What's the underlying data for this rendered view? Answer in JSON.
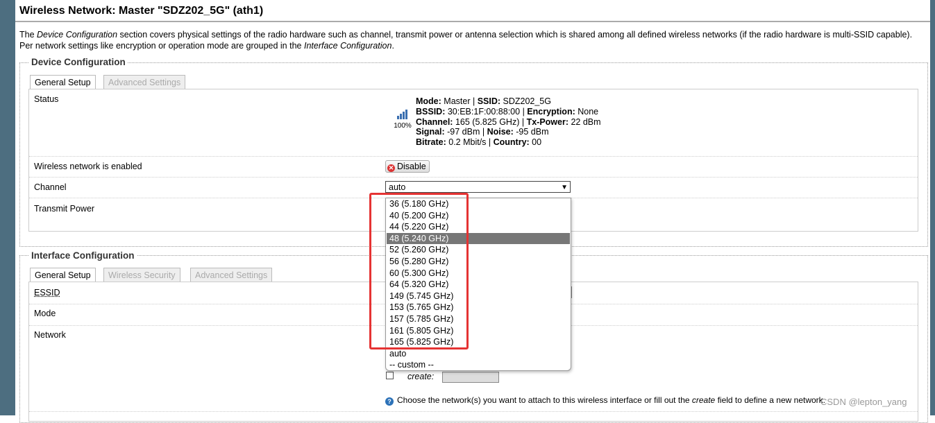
{
  "page": {
    "title": "Wireless Network: Master \"SDZ202_5G\" (ath1)",
    "description_parts": [
      "The ",
      "Device Configuration",
      " section covers physical settings of the radio hardware such as channel, transmit power or antenna selection which is shared among all defined wireless networks (if the radio hardware is multi-SSID capable). Per network settings like encryption or operation mode are grouped in the ",
      "Interface Configuration",
      "."
    ]
  },
  "device_config": {
    "legend": "Device Configuration",
    "tabs": [
      {
        "label": "General Setup",
        "active": true
      },
      {
        "label": "Advanced Settings",
        "active": false
      }
    ],
    "status_label": "Status",
    "signal_percent": "100%",
    "status_lines": [
      [
        {
          "k": "Mode:",
          "v": " Master | "
        },
        {
          "k": "SSID:",
          "v": " SDZ202_5G"
        }
      ],
      [
        {
          "k": "BSSID:",
          "v": " 30:EB:1F:00:88:00 | "
        },
        {
          "k": "Encryption:",
          "v": " None"
        }
      ],
      [
        {
          "k": "Channel:",
          "v": " 165 (5.825 GHz) | "
        },
        {
          "k": "Tx-Power:",
          "v": " 22 dBm"
        }
      ],
      [
        {
          "k": "Signal:",
          "v": " -97 dBm | "
        },
        {
          "k": "Noise:",
          "v": " -95 dBm"
        }
      ],
      [
        {
          "k": "Bitrate:",
          "v": " 0.2 Mbit/s | "
        },
        {
          "k": "Country:",
          "v": " 00"
        }
      ]
    ],
    "enabled_label": "Wireless network is enabled",
    "disable_button": "Disable",
    "channel_label": "Channel",
    "channel_value": "auto",
    "txpower_label": "Transmit Power"
  },
  "channel_dropdown": {
    "options": [
      "36 (5.180 GHz)",
      "40 (5.200 GHz)",
      "44 (5.220 GHz)",
      "48 (5.240 GHz)",
      "52 (5.260 GHz)",
      "56 (5.280 GHz)",
      "60 (5.300 GHz)",
      "64 (5.320 GHz)",
      "149 (5.745 GHz)",
      "153 (5.765 GHz)",
      "157 (5.785 GHz)",
      "161 (5.805 GHz)",
      "165 (5.825 GHz)",
      "auto",
      "-- custom --"
    ],
    "highlighted_index": 3
  },
  "interface_config": {
    "legend": "Interface Configuration",
    "tabs": [
      {
        "label": "General Setup",
        "active": true
      },
      {
        "label": "Wireless Security",
        "active": false
      },
      {
        "label": "Advanced Settings",
        "active": false
      }
    ],
    "essid_label": "ESSID",
    "mode_label": "Mode",
    "network_label": "Network",
    "create_label": "create:",
    "help_parts": [
      "Choose the network(s) you want to attach to this wireless interface or fill out the ",
      "create",
      " field to define a new network."
    ]
  },
  "watermark": "CSDN @lepton_yang",
  "colors": {
    "stripe": "#4d6e80",
    "highlight": "#777777",
    "annotation": "#e53333",
    "info": "#2c72b8"
  }
}
